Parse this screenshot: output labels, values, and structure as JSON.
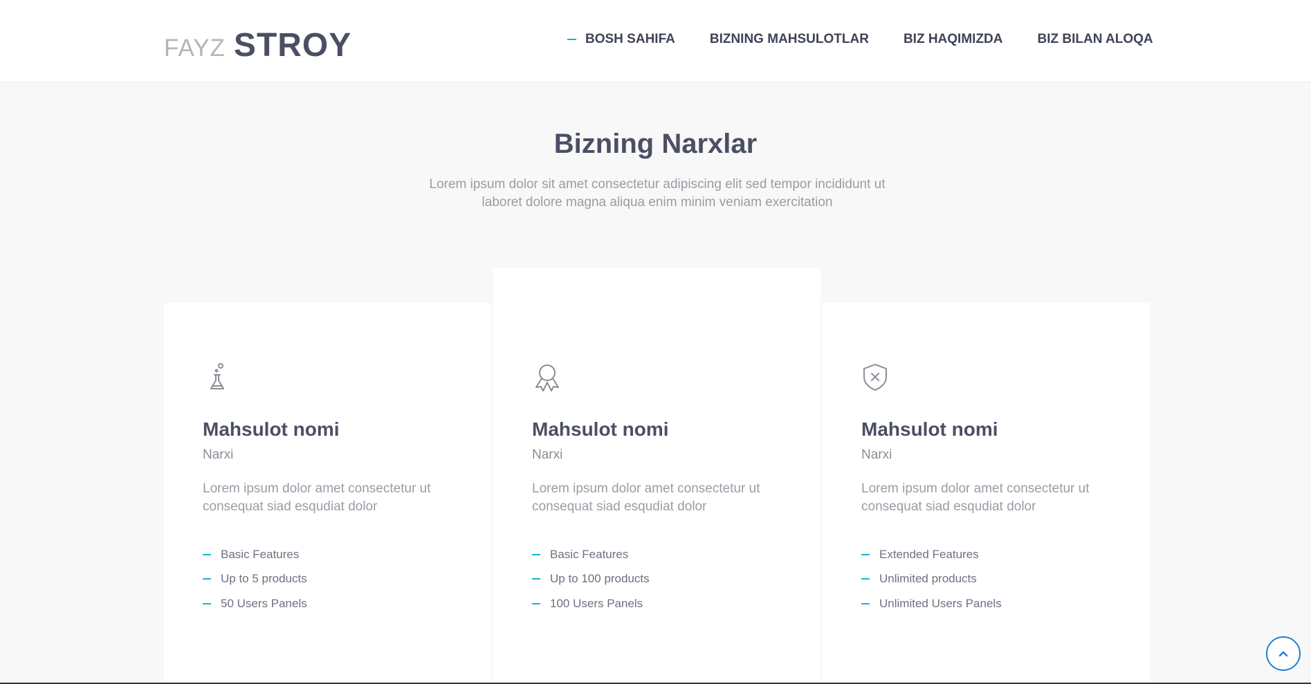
{
  "header": {
    "logo_light": "FAYZ",
    "logo_bold": "STROY",
    "nav": [
      {
        "label": "BOSH SAHIFA",
        "active": true
      },
      {
        "label": "BIZNING MAHSULOTLAR",
        "active": false
      },
      {
        "label": "BIZ HAQIMIZDA",
        "active": false
      },
      {
        "label": "BIZ BILAN ALOQA",
        "active": false
      }
    ]
  },
  "pricing": {
    "title": "Bizning Narxlar",
    "subtitle": "Lorem ipsum dolor sit amet consectetur adipiscing elit sed tempor incididunt ut laboret dolore magna aliqua enim minim veniam exercitation",
    "cards": [
      {
        "icon": "flask-icon",
        "title": "Mahsulot nomi",
        "price": "Narxi",
        "description": "Lorem ipsum dolor amet consectetur ut consequat siad esqudiat dolor",
        "features": [
          "Basic Features",
          "Up to 5 products",
          "50 Users Panels"
        ]
      },
      {
        "icon": "award-icon",
        "title": "Mahsulot nomi",
        "price": "Narxi",
        "description": "Lorem ipsum dolor amet consectetur ut consequat siad esqudiat dolor",
        "features": [
          "Basic Features",
          "Up to 100 products",
          "100 Users Panels"
        ]
      },
      {
        "icon": "shield-x-icon",
        "title": "Mahsulot nomi",
        "price": "Narxi",
        "description": "Lorem ipsum dolor amet consectetur ut consequat siad esqudiat dolor",
        "features": [
          "Extended Features",
          "Unlimited products",
          "Unlimited Users Panels"
        ]
      }
    ]
  },
  "colors": {
    "accent": "#17b3d4",
    "heading": "#4b4f63",
    "muted": "#9a9ca6",
    "to_top_border": "#1e7fd8"
  },
  "back_to_top_icon": "chevron-up-icon"
}
